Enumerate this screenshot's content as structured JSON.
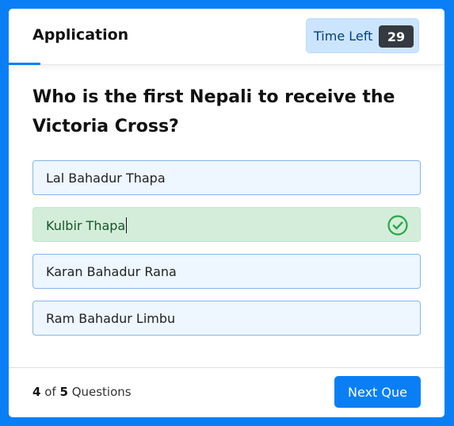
{
  "header": {
    "title": "Application",
    "timer_label": "Time Left",
    "timer_value": "29"
  },
  "question": {
    "text": "Who is the first Nepali to receive the Victoria Cross?"
  },
  "options": [
    {
      "label": "Lal Bahadur Thapa",
      "state": "default"
    },
    {
      "label": "Kulbir Thapa",
      "state": "correct",
      "icon": "check-circle-icon"
    },
    {
      "label": "Karan Bahadur Rana",
      "state": "default"
    },
    {
      "label": "Ram Bahadur Limbu",
      "state": "default"
    }
  ],
  "footer": {
    "current": "4",
    "of_text": "of",
    "total": "5",
    "questions_text": "Questions",
    "next_label": "Next Que"
  },
  "colors": {
    "accent": "#0a7ff5",
    "correct_bg": "#d4edda",
    "correct_text": "#155724",
    "correct_icon": "#28a745"
  }
}
